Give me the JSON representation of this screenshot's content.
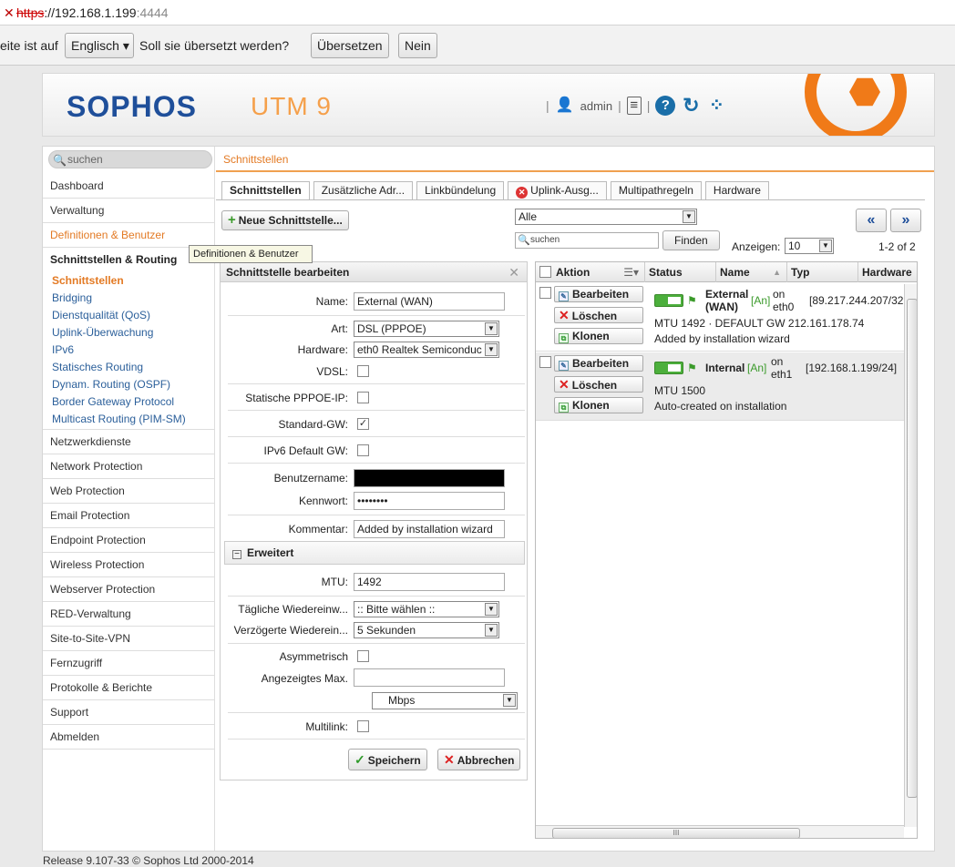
{
  "browser": {
    "url_protocol": "https",
    "url_host": "://192.168.1.199",
    "url_port": ":4444",
    "translate_prompt": "eite ist auf",
    "language_select": "Englisch",
    "translate_question": "Soll sie übersetzt werden?",
    "translate_button": "Übersetzen",
    "no_button": "Nein"
  },
  "header": {
    "logo": "SOPHOS",
    "product": "UTM 9",
    "user": "admin",
    "sep": "|"
  },
  "sidebar": {
    "search_placeholder": "suchen",
    "items_top": [
      "Dashboard",
      "Verwaltung",
      "Definitionen & Benutzer"
    ],
    "open_group": "Schnittstellen & Routing",
    "sub_items": [
      "Schnittstellen",
      "Bridging",
      "Dienstqualität (QoS)",
      "Uplink-Überwachung",
      "IPv6",
      "Statisches Routing",
      "Dynam. Routing (OSPF)",
      "Border Gateway Protocol",
      "Multicast Routing (PIM-SM)"
    ],
    "items_bottom": [
      "Netzwerkdienste",
      "Network Protection",
      "Web Protection",
      "Email Protection",
      "Endpoint Protection",
      "Wireless Protection",
      "Webserver Protection",
      "RED-Verwaltung",
      "Site-to-Site-VPN",
      "Fernzugriff",
      "Protokolle & Berichte",
      "Support",
      "Abmelden"
    ],
    "tooltip": "Definitionen & Benutzer"
  },
  "content": {
    "breadcrumb": "Schnittstellen",
    "tabs": [
      "Schnittstellen",
      "Zusätzliche Adr...",
      "Linkbündelung",
      "Uplink-Ausg...",
      "Multipathregeln",
      "Hardware"
    ],
    "new_button": "Neue Schnittstelle...",
    "filter_select": "Alle",
    "search_placeholder": "suchen",
    "find_button": "Finden",
    "show_label": "Anzeigen:",
    "show_value": "10",
    "page_count": "1-2 of 2",
    "prev_button": "«",
    "next_button": "»"
  },
  "editor": {
    "title": "Schnittstelle bearbeiten",
    "close": "✕",
    "name_label": "Name:",
    "name_value": "External (WAN)",
    "type_label": "Art:",
    "type_value": "DSL (PPPOE)",
    "hardware_label": "Hardware:",
    "hardware_value": "eth0 Realtek Semiconduc",
    "vdsl_label": "VDSL:",
    "static_ip_label": "Statische PPPOE-IP:",
    "default_gw_label": "Standard-GW:",
    "ipv6_gw_label": "IPv6 Default GW:",
    "username_label": "Benutzername:",
    "password_label": "Kennwort:",
    "password_value": "••••••••",
    "comment_label": "Kommentar:",
    "comment_value": "Added by installation wizard",
    "advanced_section": "Erweitert",
    "mtu_label": "MTU:",
    "mtu_value": "1492",
    "daily_reconnect_label": "Tägliche Wiedereinw...",
    "daily_reconnect_value": ":: Bitte wählen ::",
    "delayed_reconnect_label": "Verzögerte Wiederein...",
    "delayed_reconnect_value": "5 Sekunden",
    "asym_label": "Asymmetrisch",
    "max_label": "Angezeigtes Max.",
    "unit_value": "Mbps",
    "multilink_label": "Multilink:",
    "save_button": "Speichern",
    "cancel_button": "Abbrechen"
  },
  "grid": {
    "columns": [
      "Aktion",
      "Status",
      "Name",
      "Typ",
      "Hardware"
    ],
    "edit_label": "Bearbeiten",
    "delete_label": "Löschen",
    "clone_label": "Klonen",
    "on_label": "on",
    "an_label": "[An]",
    "rows": [
      {
        "name": "External",
        "name2": "(WAN)",
        "hw": "eth0",
        "ip": "[89.217.244.207/32",
        "line1": "MTU 1492 · DEFAULT GW 212.161.178.74",
        "line2": "Added by installation wizard"
      },
      {
        "name": "Internal",
        "hw": "eth1",
        "ip": "[192.168.1.199/24]",
        "line1": "MTU 1500",
        "line2": "Auto-created on installation"
      }
    ]
  },
  "footer": "Release 9.107-33  © Sophos Ltd 2000-2014"
}
